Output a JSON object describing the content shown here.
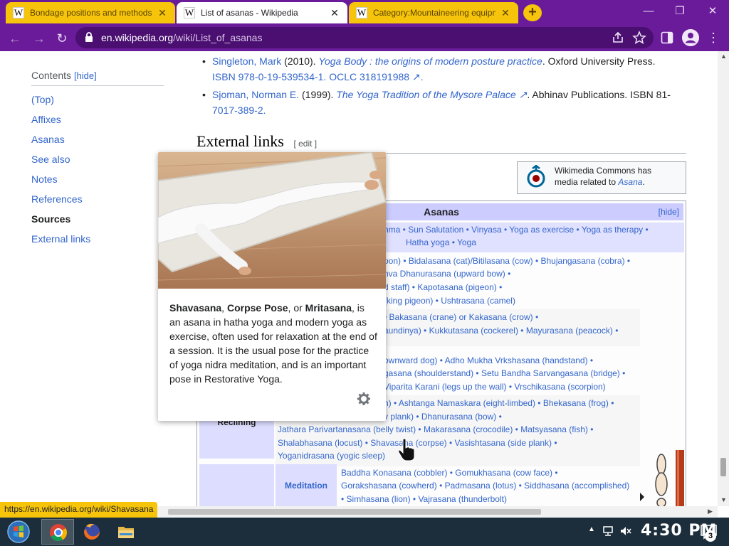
{
  "browser": {
    "tabs": [
      {
        "title": "Bondage positions and methods",
        "favicon": "W",
        "state": "inactive"
      },
      {
        "title": "List of asanas - Wikipedia",
        "favicon": "W",
        "state": "active"
      },
      {
        "title": "Category:Mountaineering equipment",
        "favicon": "W",
        "state": "inactive"
      }
    ],
    "tab_close": "✕",
    "new_tab": "+",
    "window_controls": {
      "minimize": "—",
      "restore": "❐",
      "close": "✕"
    },
    "address": {
      "host": "en.wikipedia.org",
      "path": "/wiki/List_of_asanas"
    },
    "nav": {
      "back": "←",
      "forward": "→",
      "reload": "↻"
    },
    "menu": "⋮"
  },
  "toc": {
    "heading": "Contents",
    "hide": "[hide]",
    "items": [
      {
        "label": "(Top)",
        "current": false
      },
      {
        "label": "Affixes",
        "current": false
      },
      {
        "label": "Asanas",
        "current": false
      },
      {
        "label": "See also",
        "current": false
      },
      {
        "label": "Notes",
        "current": false
      },
      {
        "label": "References",
        "current": false
      },
      {
        "label": "Sources",
        "current": true
      },
      {
        "label": "External links",
        "current": false
      }
    ]
  },
  "sources": [
    {
      "author": "Singleton, Mark",
      "year": " (2010). ",
      "title": "Yoga Body : the origins of modern posture practice",
      "rest": ". Oxford University Press.",
      "line2": "ISBN 978-0-19-539534-1. OCLC 318191988 ↗."
    },
    {
      "author": "Sjoman, Norman E.",
      "year": " (1999). ",
      "title": "The Yoga Tradition of the Mysore Palace ↗",
      "rest": ". Abhinav Publications. ISBN 81-",
      "line2": "7017-389-2."
    }
  ],
  "external_links": {
    "heading": "External links",
    "edit": "[ edit ]"
  },
  "commons": {
    "line1": "Wikimedia Commons has",
    "line2a": "media related to ",
    "line2b": "Asana",
    "line2c": "."
  },
  "navbox": {
    "title": "Asanas",
    "hide": "[hide]",
    "rows": [
      "nma • Sun Salutation • Vinyasa • Yoga as exercise • Yoga as therapy •",
      "Hatha yoga • Yoga",
      "oon) • Bidalasana (cat)/Bitilasana (cow) • Bhujangasana (cobra) •",
      "nva Dhanurasana (upward bow) •",
      "d staff) • Kapotasana (pigeon) •",
      "(king pigeon) • Ushtrasana (camel)",
      "• Bakasana (crane) or Kakasana (crow) •",
      "aundinya) • Kukkutasana (cockerel) • Mayurasana (peacock) •",
      "ownward dog) • Adho Mukha Vrkshasana (handstand) •",
      "gasana (shoulderstand) • Setu Bandha Sarvangasana (bridge) •",
      "Viparita Karani (legs up the wall) • Vrschikasana (scorpion)",
      "n) • Ashtanga Namaskara (eight-limbed) • Bhekasana (frog) •",
      "v plank) • Dhanurasana (bow) •",
      "Jathara Parivartanasana (belly twist) • Makarasana (crocodile) • Matsyasana (fish) •",
      "Shalabhasana (locust) • Shavasana (corpse) • Vasishtasana (side plank) •",
      "Yoganidrasana (yogic sleep)",
      "Baddha Konasana (cobbler) • Gomukhasana (cow face) •",
      "Gorakshasana (cowherd) • Padmasana (lotus) • Siddhasana (accomplished)",
      "• Simhasana (lion) • Vajrasana (thunderbolt)"
    ],
    "groups": {
      "reclining": "Reclining",
      "meditation": "Meditation"
    }
  },
  "hovercard": {
    "b1": "Shavasana",
    "t1": ", ",
    "b2": "Corpse Pose",
    "t2": ", or ",
    "b3": "Mritasana",
    "t3": ", is an asana in hatha yoga and modern yoga as exercise, often used for relaxation at the end of a session. It is the usual pose for the practice of yoga nidra meditation, and is an important pose in Restorative Yoga."
  },
  "status_url": "https://en.wikipedia.org/wiki/Shavasana",
  "taskbar": {
    "clock": "4:30 PM",
    "notification_count": "3",
    "tray_arrow": "▲"
  },
  "colors": {
    "chrome_purple": "#6a1b9a",
    "tab_yellow": "#f6c40a",
    "link_blue": "#3366cc",
    "navbox_title": "#ccccff",
    "taskbar": "#1c2e3b"
  }
}
